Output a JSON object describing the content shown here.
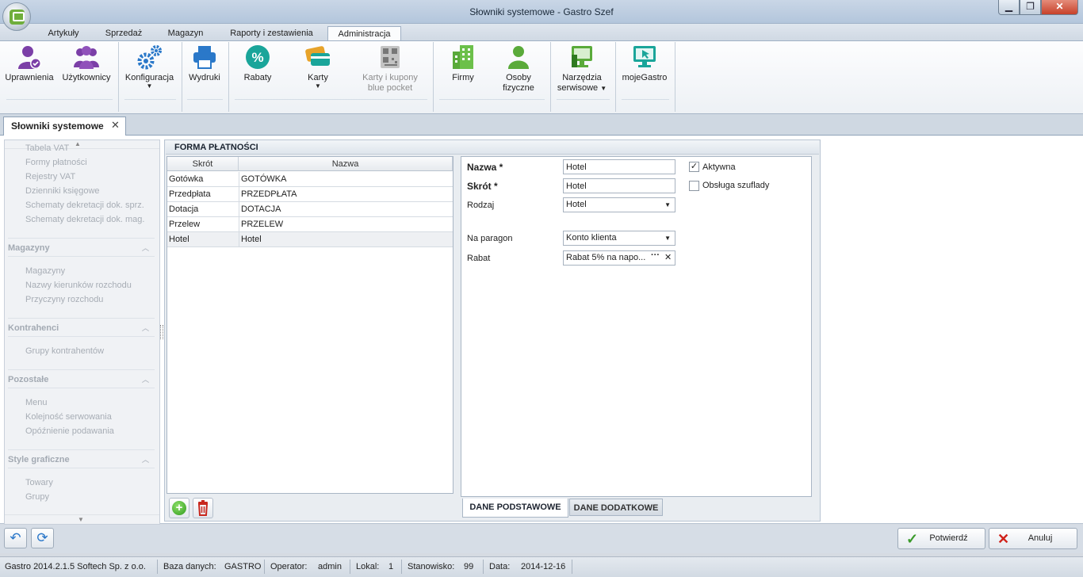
{
  "window": {
    "title": "Słowniki systemowe - Gastro Szef",
    "min_glyph": "▁",
    "max_glyph": "❐",
    "close_glyph": "✕"
  },
  "ribbon_tabs": [
    "Artykuły",
    "Sprzedaż",
    "Magazyn",
    "Raporty i zestawienia",
    "Administracja"
  ],
  "ribbon_buttons": {
    "uprawnienia": "Uprawnienia",
    "uzytkownicy": "Użytkownicy",
    "konfiguracja": "Konfiguracja",
    "wydruki": "Wydruki",
    "rabaty": "Rabaty",
    "karty": "Karty",
    "karty_kupony_1": "Karty i kupony",
    "karty_kupony_2": "blue pocket",
    "firmy": "Firmy",
    "osoby_1": "Osoby",
    "osoby_2": "fizyczne",
    "narzedzia_1": "Narzędzia",
    "narzedzia_2": "serwisowe",
    "mojegastro": "mojeGastro",
    "dropdown_glyph": "▼",
    "percent_glyph": "%"
  },
  "doc_tab": {
    "label": "Słowniki systemowe",
    "close": "✕"
  },
  "nav": {
    "scroll_up": "▲",
    "scroll_down": "▼",
    "collapse_glyph": "︿",
    "top_items": [
      "Tabela VAT",
      "Formy płatności",
      "Rejestry VAT",
      "Dzienniki księgowe",
      "Schematy dekretacji dok. sprz.",
      "Schematy dekretacji dok. mag."
    ],
    "sections": [
      {
        "title": "Magazyny",
        "items": [
          "Magazyny",
          "Nazwy kierunków rozchodu",
          "Przyczyny rozchodu"
        ]
      },
      {
        "title": "Kontrahenci",
        "items": [
          "Grupy kontrahentów"
        ]
      },
      {
        "title": "Pozostałe",
        "items": [
          "Menu",
          "Kolejność serwowania",
          "Opóźnienie podawania"
        ]
      },
      {
        "title": "Style graficzne",
        "items": [
          "Towary",
          "Grupy"
        ]
      }
    ]
  },
  "panel": {
    "title": "FORMA PŁATNOŚCI",
    "columns": [
      "Skrót",
      "Nazwa"
    ],
    "rows": [
      {
        "skrot": "Gotówka",
        "nazwa": "GOTÓWKA"
      },
      {
        "skrot": "Przedpłata",
        "nazwa": "PRZEDPŁATA"
      },
      {
        "skrot": "Dotacja",
        "nazwa": "DOTACJA"
      },
      {
        "skrot": "Przelew",
        "nazwa": "PRZELEW"
      },
      {
        "skrot": "Hotel",
        "nazwa": "Hotel"
      }
    ],
    "selected_row": 4,
    "add_glyph": "+"
  },
  "form": {
    "nazwa_label": "Nazwa *",
    "nazwa_value": "Hotel",
    "skrot_label": "Skrót *",
    "skrot_value": "Hotel",
    "rodzaj_label": "Rodzaj",
    "rodzaj_value": "Hotel",
    "na_paragon_label": "Na paragon",
    "na_paragon_value": "Konto klienta",
    "rabat_label": "Rabat",
    "rabat_value": "Rabat 5% na napo...",
    "rabat_more": "···",
    "rabat_clear": "✕",
    "aktywna_label": "Aktywna",
    "aktywna_checked": true,
    "szuflada_label": "Obsługa szuflady",
    "szuflada_checked": false,
    "check_glyph": "✓",
    "dropdown_glyph": "▼",
    "tabs": [
      "DANE PODSTAWOWE",
      "DANE DODATKOWE"
    ]
  },
  "actions": {
    "back_glyph": "↶",
    "refresh_glyph": "⟳",
    "confirm_glyph": "✓",
    "cancel_glyph": "✕",
    "confirm": "Potwierdź",
    "cancel": "Anuluj"
  },
  "status": {
    "version": "Gastro 2014.2.1.5  Softech Sp. z o.o.",
    "db_label": "Baza danych:",
    "db_value": "GASTRO",
    "operator_label": "Operator:",
    "operator_value": "admin",
    "lokal_label": "Lokal:",
    "lokal_value": "1",
    "stanowisko_label": "Stanowisko:",
    "stanowisko_value": "99",
    "data_label": "Data:",
    "data_value": "2014-12-16"
  },
  "colors": {
    "accent_tab": "#fbfcfd",
    "icon_purple": "#7b3fa7",
    "icon_blue": "#2a78c9",
    "icon_teal": "#1aa59a",
    "icon_green": "#5aaa3a",
    "confirm_green": "#3a9a2a",
    "cancel_red": "#d0221a"
  }
}
